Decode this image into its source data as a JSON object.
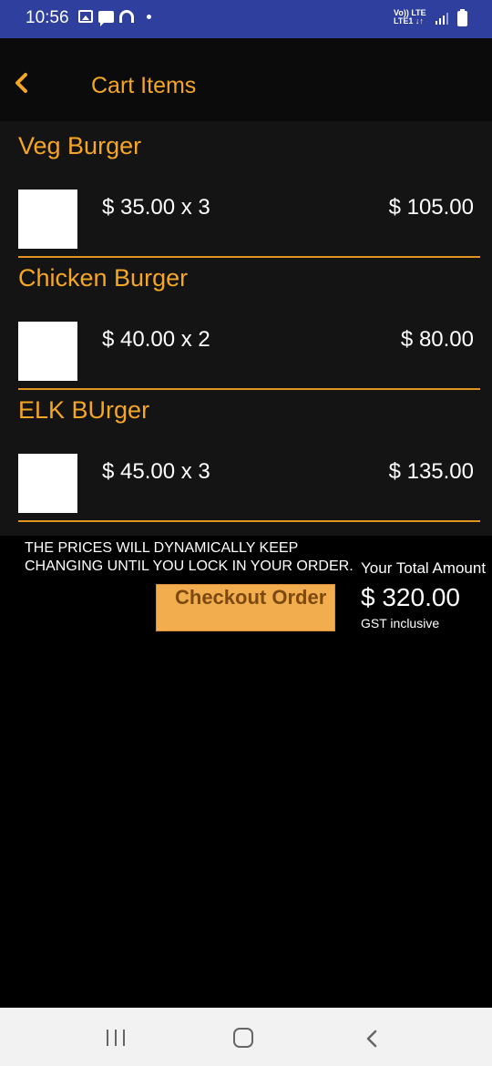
{
  "status_bar": {
    "time": "10:56",
    "network_line1": "Vo)) LTE",
    "network_line2": "LTE1 ↓↑",
    "icons": [
      "gallery-icon",
      "message-icon",
      "hotspot-icon",
      "dot-icon",
      "signal-icon",
      "battery-icon"
    ]
  },
  "header": {
    "back_icon": "chevron-left-icon",
    "title": "Cart Items"
  },
  "cart": {
    "items": [
      {
        "name": "Veg Burger",
        "price_qty": "$ 35.00 x 3",
        "total": "$ 105.00"
      },
      {
        "name": "Chicken Burger",
        "price_qty": "$ 40.00 x 2",
        "total": "$ 80.00"
      },
      {
        "name": "ELK BUrger",
        "price_qty": "$ 45.00 x 3",
        "total": "$ 135.00"
      }
    ]
  },
  "summary": {
    "notice": "THE PRICES WILL DYNAMICALLY KEEP CHANGING UNTIL YOU LOCK IN YOUR ORDER.",
    "total_label": "Your Total Amount",
    "checkout_label": "Checkout Order",
    "total_amount": "$ 320.00",
    "gst_note": "GST inclusive"
  },
  "nav_bar": {
    "icons": [
      "recents-icon",
      "home-icon",
      "back-icon"
    ]
  },
  "colors": {
    "accent": "#f5a623",
    "status_bar": "#2f3f9e",
    "panel": "#141414",
    "button": "#f2ad4e"
  }
}
